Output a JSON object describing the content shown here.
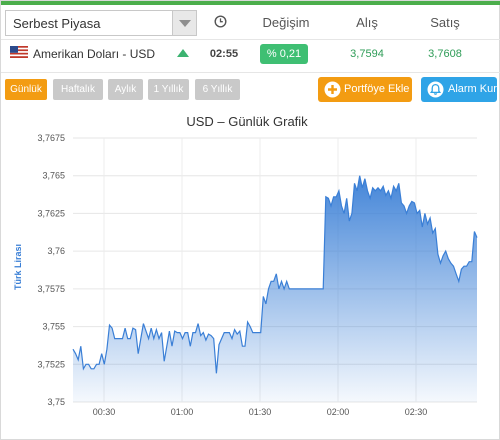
{
  "market_select": {
    "value": "Serbest Piyasa"
  },
  "header": {
    "change_label": "Değişim",
    "buy_label": "Alış",
    "sell_label": "Satış"
  },
  "currency_row": {
    "name": "Amerikan Doları - USD",
    "time": "02:55",
    "change": "% 0,21",
    "buy": "3,7594",
    "sell": "3,7608",
    "trend": "up"
  },
  "periods": [
    {
      "label": "Günlük",
      "active": true
    },
    {
      "label": "Haftalık",
      "active": false
    },
    {
      "label": "Aylık",
      "active": false
    },
    {
      "label": "1 Yıllık",
      "active": false
    },
    {
      "label": "6 Yıllık",
      "active": false
    }
  ],
  "actions": {
    "portfolio_label": "Portföye Ekle",
    "alarm_label": "Alarm Kur"
  },
  "icons": [
    "chevron-down-icon",
    "clock-icon",
    "us-flag-icon",
    "up-arrow-icon",
    "plus-circle-icon",
    "bell-icon"
  ],
  "colors": {
    "accent_orange": "#f39c12",
    "accent_blue": "#2fa4e7",
    "positive_green": "#3fbf73",
    "chart_line": "#3a7fd6"
  },
  "chart_data": {
    "type": "area",
    "title": "USD – Günlük Grafik",
    "xlabel": "",
    "ylabel": "Türk Lirası",
    "ylim": [
      3.75,
      3.7675
    ],
    "y_ticks": [
      "3,75",
      "3,7525",
      "3,755",
      "3,7575",
      "3,76",
      "3,7625",
      "3,765",
      "3,7675"
    ],
    "x_range_minutes": [
      13,
      66
    ],
    "x_ticks": [
      {
        "label": "00:30",
        "minute": 30
      },
      {
        "label": "01:00",
        "minute": 60
      },
      {
        "label": "01:30",
        "minute": 90
      },
      {
        "label": "02:00",
        "minute": 120
      },
      {
        "label": "02:30",
        "minute": 150
      }
    ],
    "series": [
      {
        "points": [
          [
            13,
            3.7535
          ],
          [
            14,
            3.7532
          ],
          [
            15,
            3.7528
          ],
          [
            16,
            3.7537
          ],
          [
            17,
            3.7522
          ],
          [
            18,
            3.7525
          ],
          [
            19,
            3.7525
          ],
          [
            20,
            3.7522
          ],
          [
            21,
            3.7522
          ],
          [
            22,
            3.7525
          ],
          [
            23,
            3.7525
          ],
          [
            24,
            3.7532
          ],
          [
            25,
            3.7525
          ],
          [
            26,
            3.7535
          ],
          [
            27,
            3.7551
          ],
          [
            28,
            3.7549
          ],
          [
            29,
            3.7542
          ],
          [
            30,
            3.7542
          ],
          [
            31,
            3.7542
          ],
          [
            32,
            3.7542
          ],
          [
            33,
            3.7549
          ],
          [
            34,
            3.7542
          ],
          [
            35,
            3.7542
          ],
          [
            36,
            3.7549
          ],
          [
            37,
            3.7548
          ],
          [
            38,
            3.7532
          ],
          [
            39,
            3.7542
          ],
          [
            40,
            3.7552
          ],
          [
            41,
            3.7547
          ],
          [
            42,
            3.7542
          ],
          [
            43,
            3.7549
          ],
          [
            44,
            3.7542
          ],
          [
            45,
            3.7548
          ],
          [
            46,
            3.7542
          ],
          [
            47,
            3.7546
          ],
          [
            48,
            3.7527
          ],
          [
            49,
            3.7537
          ],
          [
            50,
            3.7547
          ],
          [
            51,
            3.7537
          ],
          [
            52,
            3.7547
          ],
          [
            53,
            3.7546
          ],
          [
            54,
            3.7546
          ],
          [
            55,
            3.7542
          ],
          [
            56,
            3.7546
          ],
          [
            57,
            3.7546
          ],
          [
            58,
            3.7537
          ],
          [
            59,
            3.7546
          ],
          [
            60,
            3.7546
          ],
          [
            61,
            3.7552
          ],
          [
            62,
            3.7544
          ],
          [
            63,
            3.7546
          ],
          [
            64,
            3.7541
          ],
          [
            65,
            3.7545
          ],
          [
            66,
            3.7544
          ],
          [
            67,
            3.7542
          ],
          [
            68,
            3.7519
          ],
          [
            69,
            3.7538
          ],
          [
            70,
            3.7542
          ],
          [
            71,
            3.7546
          ],
          [
            72,
            3.7546
          ],
          [
            73,
            3.7546
          ],
          [
            74,
            3.7542
          ],
          [
            75,
            3.7548
          ],
          [
            76,
            3.7545
          ],
          [
            77,
            3.7547
          ],
          [
            78,
            3.7537
          ],
          [
            79,
            3.7537
          ],
          [
            80,
            3.7553
          ],
          [
            81,
            3.755
          ],
          [
            82,
            3.7546
          ],
          [
            83,
            3.7546
          ],
          [
            84,
            3.7546
          ],
          [
            85,
            3.7546
          ],
          [
            86,
            3.757
          ],
          [
            87,
            3.7565
          ],
          [
            88,
            3.7575
          ],
          [
            89,
            3.758
          ],
          [
            90,
            3.758
          ],
          [
            91,
            3.7585
          ],
          [
            92,
            3.7575
          ],
          [
            93,
            3.758
          ],
          [
            94,
            3.7575
          ],
          [
            95,
            3.758
          ],
          [
            96,
            3.7575
          ],
          [
            97,
            3.7575
          ],
          [
            98,
            3.7575
          ],
          [
            99,
            3.7575
          ],
          [
            100,
            3.7575
          ],
          [
            101,
            3.7575
          ],
          [
            102,
            3.7575
          ],
          [
            103,
            3.7575
          ],
          [
            104,
            3.7575
          ],
          [
            105,
            3.7575
          ],
          [
            106,
            3.7575
          ],
          [
            107,
            3.7575
          ],
          [
            108,
            3.7575
          ],
          [
            109,
            3.7575
          ],
          [
            110,
            3.7636
          ],
          [
            111,
            3.7635
          ],
          [
            112,
            3.763
          ],
          [
            113,
            3.7636
          ],
          [
            114,
            3.7636
          ],
          [
            115,
            3.764
          ],
          [
            116,
            3.763
          ],
          [
            117,
            3.7625
          ],
          [
            118,
            3.7635
          ],
          [
            119,
            3.762
          ],
          [
            120,
            3.7625
          ],
          [
            121,
            3.7645
          ],
          [
            122,
            3.764
          ],
          [
            123,
            3.765
          ],
          [
            124,
            3.7642
          ],
          [
            125,
            3.7648
          ],
          [
            126,
            3.764
          ],
          [
            127,
            3.7635
          ],
          [
            128,
            3.7642
          ],
          [
            129,
            3.764
          ],
          [
            130,
            3.7642
          ],
          [
            131,
            3.764
          ],
          [
            132,
            3.7643
          ],
          [
            133,
            3.7637
          ],
          [
            134,
            3.764
          ],
          [
            135,
            3.7635
          ],
          [
            136,
            3.7643
          ],
          [
            137,
            3.764
          ],
          [
            138,
            3.7645
          ],
          [
            139,
            3.7632
          ],
          [
            140,
            3.763
          ],
          [
            141,
            3.7625
          ],
          [
            142,
            3.763
          ],
          [
            143,
            3.7633
          ],
          [
            144,
            3.7632
          ],
          [
            145,
            3.7625
          ],
          [
            146,
            3.7627
          ],
          [
            147,
            3.7616
          ],
          [
            148,
            3.7625
          ],
          [
            149,
            3.7618
          ],
          [
            150,
            3.7622
          ],
          [
            151,
            3.7612
          ],
          [
            152,
            3.7615
          ],
          [
            153,
            3.7598
          ],
          [
            154,
            3.7592
          ],
          [
            155,
            3.7597
          ],
          [
            156,
            3.76
          ],
          [
            157,
            3.7595
          ],
          [
            158,
            3.7592
          ],
          [
            159,
            3.759
          ],
          [
            160,
            3.7585
          ],
          [
            161,
            3.758
          ],
          [
            162,
            3.7588
          ],
          [
            163,
            3.759
          ],
          [
            164,
            3.759
          ],
          [
            165,
            3.7593
          ],
          [
            166,
            3.7593
          ],
          [
            167,
            3.7613
          ],
          [
            168,
            3.7609
          ]
        ]
      }
    ],
    "grid": true,
    "legend": "none"
  }
}
